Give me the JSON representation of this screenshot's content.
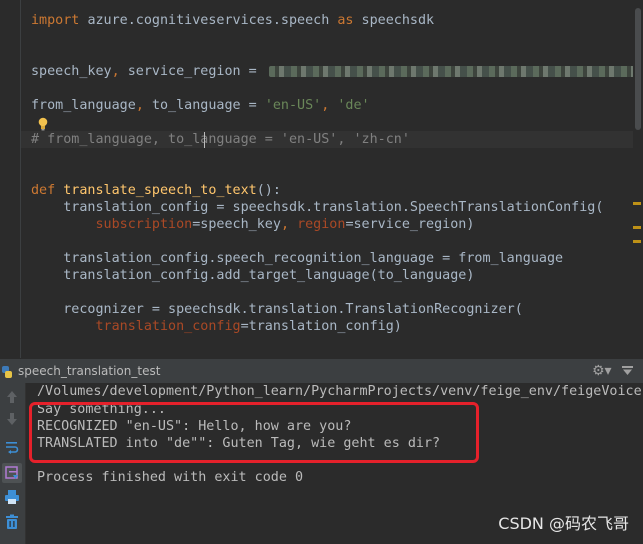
{
  "editor": {
    "lines": [
      {
        "parts": [
          {
            "c": "kw",
            "t": "import "
          },
          {
            "c": "mod",
            "t": "azure.cognitiveservices.speech "
          },
          {
            "c": "kw",
            "t": "as "
          },
          {
            "c": "mod",
            "t": "speechsdk"
          }
        ]
      },
      {
        "parts": [
          {
            "c": "mod",
            "t": "speech_key"
          },
          {
            "c": "kw",
            "t": ", "
          },
          {
            "c": "mod",
            "t": "service_region = "
          }
        ]
      },
      {
        "parts": [
          {
            "c": "mod",
            "t": "from_language"
          },
          {
            "c": "kw",
            "t": ", "
          },
          {
            "c": "mod",
            "t": "to_language = "
          },
          {
            "c": "str",
            "t": "'en-US'"
          },
          {
            "c": "kw",
            "t": ", "
          },
          {
            "c": "str",
            "t": "'de'"
          }
        ]
      },
      {
        "parts": [
          {
            "c": "cmt",
            "t": "# from_language, to_language = 'en-US', 'zh-cn'"
          }
        ]
      },
      {
        "parts": [
          {
            "c": "kw",
            "t": "def "
          },
          {
            "c": "fn",
            "t": "translate_speech_to_text"
          },
          {
            "c": "mod",
            "t": "():"
          }
        ]
      },
      {
        "parts": [
          {
            "c": "mod",
            "t": "    translation_config = speechsdk.translation.SpeechTranslationConfig("
          }
        ]
      },
      {
        "parts": [
          {
            "c": "mod",
            "t": "        "
          },
          {
            "c": "prm",
            "t": "subscription"
          },
          {
            "c": "mod",
            "t": "=speech_key"
          },
          {
            "c": "kw",
            "t": ", "
          },
          {
            "c": "prm",
            "t": "region"
          },
          {
            "c": "mod",
            "t": "=service_region)"
          }
        ]
      },
      {
        "parts": [
          {
            "c": "mod",
            "t": "    translation_config.speech_recognition_language = from_language"
          }
        ]
      },
      {
        "parts": [
          {
            "c": "mod",
            "t": "    translation_config.add_target_language(to_language)"
          }
        ]
      },
      {
        "parts": [
          {
            "c": "mod",
            "t": "    recognizer = speechsdk.translation.TranslationRecognizer("
          }
        ]
      },
      {
        "parts": [
          {
            "c": "mod",
            "t": "        "
          },
          {
            "c": "prm",
            "t": "translation_config"
          },
          {
            "c": "mod",
            "t": "=translation_config)"
          }
        ]
      }
    ]
  },
  "run_window": {
    "title": "speech_translation_test",
    "output": [
      "/Volumes/development/Python_learn/PycharmProjects/venv/feige_env/feigeVoice",
      "Say something...",
      "RECOGNIZED \"en-US\": Hello, how are you?",
      "TRANSLATED into \"de\"\": Guten Tag, wie geht es dir?",
      "",
      "Process finished with exit code 0"
    ]
  },
  "watermark": "CSDN @码农飞哥",
  "colors": {
    "background": "#2b2b2b",
    "keyword": "#cc7832",
    "string": "#6a8759",
    "function": "#ffc66d",
    "param": "#aa4926",
    "highlight_box": "#e5212b"
  }
}
